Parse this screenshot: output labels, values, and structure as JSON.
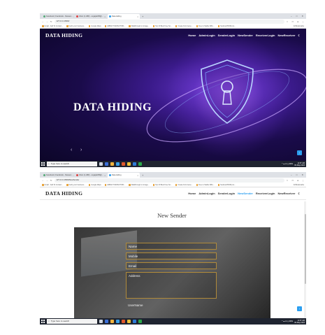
{
  "browser": {
    "tabs": [
      {
        "label": "Facebook | Facebook - Naveen...",
        "active": false
      },
      {
        "label": "Inbox (1,480) - ucgajwb95@...",
        "active": false
      },
      {
        "label": "Data Hiding",
        "active": true
      }
    ],
    "newtab": "+",
    "window_controls": [
      "–",
      "□",
      "✕"
    ],
    "url_page1": "127.0.0.1:8000/",
    "url_page2": "127.0.0.1:8000/NewSender",
    "bookmarks": [
      "Gmail · Add To Contact...",
      "Verify your business...",
      "Google Maps",
      "ARBACT DETECTION...",
      "Walkthrough on image...",
      "Top 20 Best Free So...",
      "Create Font Gene...",
      "Free to Stable Diffu...",
      "SoulmelVMVM pro..."
    ],
    "other_bookmarks": "All Bookmarks"
  },
  "site": {
    "brand": "DATA HIDING",
    "nav": [
      "Home",
      "AdminLogin",
      "SenderLogin",
      "NewSender",
      "ReceiverLogin",
      "NewReceiver"
    ],
    "theme_icon": "moon-icon"
  },
  "page1": {
    "hero_title": "DATA HIDING",
    "prev_arrow": "‹",
    "next_arrow": "›",
    "slide_count": 3,
    "active_slide": 0
  },
  "page2": {
    "section_title": "New Sender",
    "fields": [
      {
        "label": "Name",
        "type": "text"
      },
      {
        "label": "Mobile",
        "type": "text"
      },
      {
        "label": "Email",
        "type": "text"
      },
      {
        "label": "Address",
        "type": "textarea"
      },
      {
        "label": "UserName",
        "type": "text"
      }
    ]
  },
  "taskbar": {
    "search_placeholder": "Type here to search",
    "tray_text": "^ ☁ ⊕ ◎ ENG",
    "time": "11:57 AM",
    "date": "06-May-2024"
  },
  "colors": {
    "accent": "#2a9ef0",
    "field_border": "#b08a3a",
    "hero_dark": "#0c0628",
    "hero_light": "#6a3ad0"
  }
}
